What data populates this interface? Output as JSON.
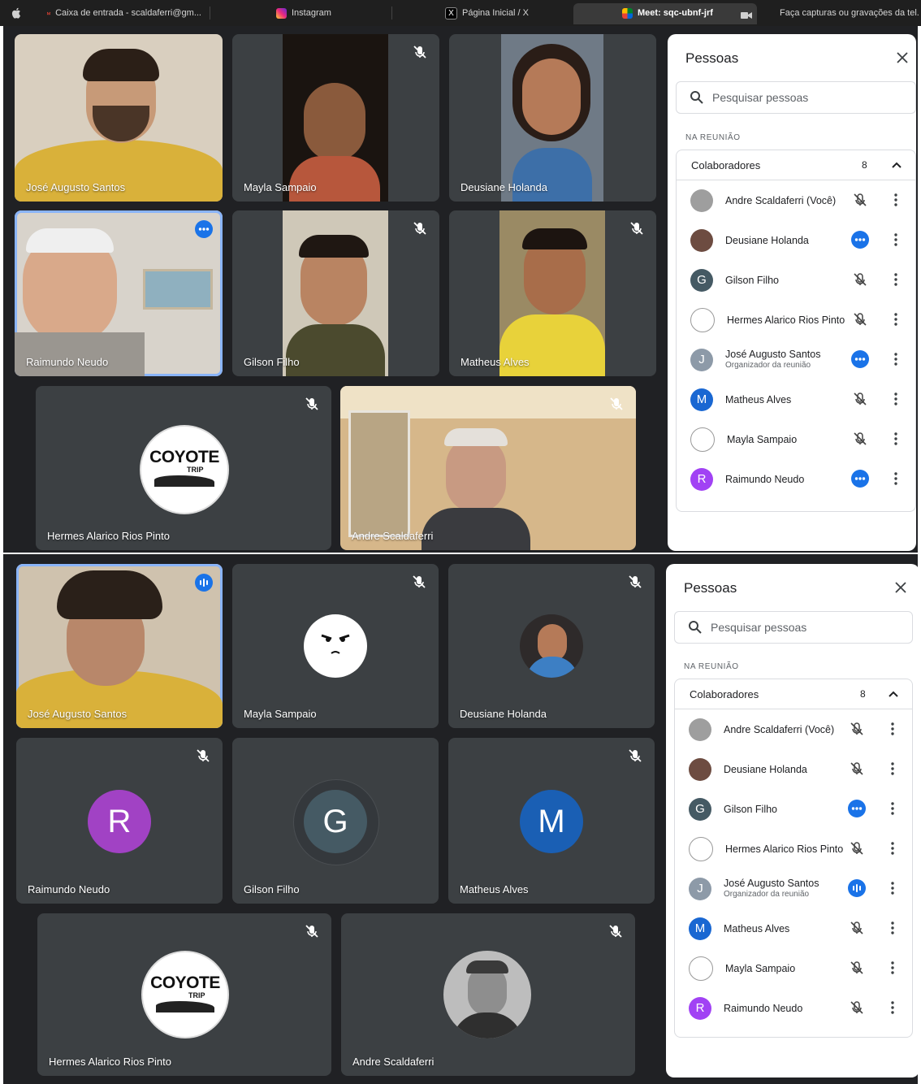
{
  "tabs": [
    {
      "label": "",
      "icon": "apple-icon"
    },
    {
      "label": "Caixa de entrada - scaldaferri@gm...",
      "icon": "gmail-icon"
    },
    {
      "label": "Instagram",
      "icon": "instagram-icon"
    },
    {
      "label": "Página Inicial / X",
      "icon": "x-icon"
    },
    {
      "label": "Meet: sqc-ubnf-jrf",
      "icon": "meet-icon",
      "active": true
    },
    {
      "label": "Faça capturas ou gravações da tel...",
      "icon": "apple-icon"
    }
  ],
  "colors": {
    "meet_bg": "#202124",
    "tile_bg": "#3c4043",
    "accent": "#1a73e8",
    "speaking": "#8ab4f8"
  },
  "top": {
    "tiles": [
      {
        "name": "José Augusto Santos"
      },
      {
        "name": "Mayla Sampaio"
      },
      {
        "name": "Deusiane Holanda"
      },
      {
        "name": "Raimundo Neudo"
      },
      {
        "name": "Gilson Filho"
      },
      {
        "name": "Matheus Alves"
      },
      {
        "name": "Hermes Alarico Rios Pinto",
        "logo_line1": "COYOTE",
        "logo_line2": "TRIP"
      },
      {
        "name": "Andre Scaldaferri"
      }
    ]
  },
  "bottom": {
    "tiles": [
      {
        "name": "José Augusto Santos"
      },
      {
        "name": "Mayla Sampaio"
      },
      {
        "name": "Deusiane Holanda"
      },
      {
        "name": "Raimundo Neudo",
        "initial": "R"
      },
      {
        "name": "Gilson Filho",
        "initial": "G"
      },
      {
        "name": "Matheus Alves",
        "initial": "M"
      },
      {
        "name": "Hermes Alarico Rios Pinto",
        "logo_line1": "COYOTE",
        "logo_line2": "TRIP"
      },
      {
        "name": "Andre Scaldaferri"
      }
    ]
  },
  "panel": {
    "title": "Pessoas",
    "search_placeholder": "Pesquisar pessoas",
    "section_label": "NA REUNIÃO",
    "group_label": "Colaboradores",
    "group_count": "8",
    "people": [
      {
        "name": "Andre Scaldaferri (Você)",
        "initial": "",
        "color": "#9e9e9e"
      },
      {
        "name": "Deusiane Holanda",
        "initial": "",
        "color": "#6d4c41"
      },
      {
        "name": "Gilson Filho",
        "initial": "G",
        "color": "#455a64"
      },
      {
        "name": "Hermes Alarico Rios Pinto",
        "initial": "",
        "color": "#ffffff"
      },
      {
        "name": "José Augusto Santos",
        "sub": "Organizador da reunião",
        "initial": "J",
        "color": "#8d9aa8"
      },
      {
        "name": "Matheus Alves",
        "initial": "M",
        "color": "#1967d2"
      },
      {
        "name": "Mayla Sampaio",
        "initial": "",
        "color": "#ffffff"
      },
      {
        "name": "Raimundo Neudo",
        "initial": "R",
        "color": "#a142f4"
      }
    ],
    "top_status": [
      "muted",
      "dots",
      "muted",
      "muted",
      "dots",
      "muted",
      "muted",
      "dots"
    ],
    "bottom_status": [
      "muted",
      "muted",
      "dots",
      "muted",
      "speaking",
      "muted",
      "muted",
      "muted"
    ]
  }
}
